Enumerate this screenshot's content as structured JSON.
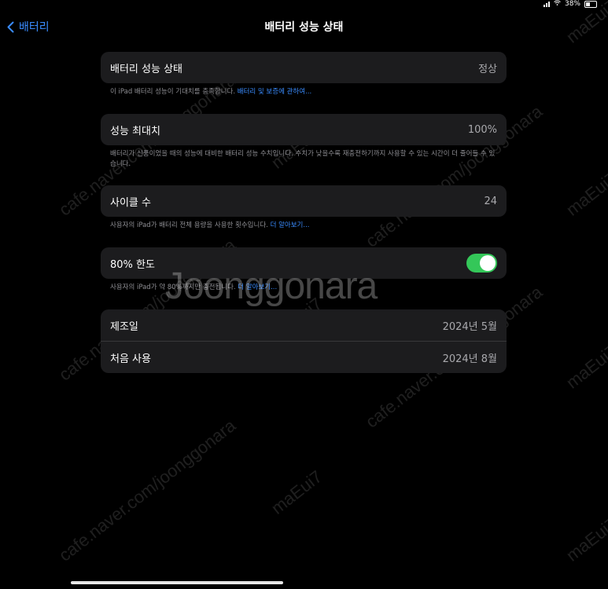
{
  "status_bar": {
    "battery_pct": "38%"
  },
  "nav": {
    "back_label": "배터리",
    "title": "배터리 성능 상태"
  },
  "health": {
    "label": "배터리 성능 상태",
    "value": "정상",
    "footnote": "이 iPad 배터리 성능이 기대치를 충족합니다.",
    "footnote_link": "배터리 및 보증에 관하여..."
  },
  "max_capacity": {
    "label": "성능 최대치",
    "value": "100%",
    "footnote": "배터리가 신품이었을 때의 성능에 대비한 배터리 성능 수치입니다. 수치가 낮을수록 재충전하기까지 사용할 수 있는 시간이 더 줄어들 수 있습니다."
  },
  "cycle_count": {
    "label": "사이클 수",
    "value": "24",
    "footnote": "사용자의 iPad가 배터리 전체 용량을 사용한 횟수입니다.",
    "footnote_link": "더 알아보기..."
  },
  "limit": {
    "label": "80% 한도",
    "enabled": true,
    "footnote": "사용자의 iPad가 약 80%까지만 충전됩니다.",
    "footnote_link": "더 알아보기..."
  },
  "dates": {
    "manufacture_label": "제조일",
    "manufacture_value": "2024년 5월",
    "first_use_label": "처음 사용",
    "first_use_value": "2024년 8월"
  },
  "watermarks": {
    "center": "Joonggonara",
    "url": "cafe.naver.com/joonggonara",
    "user": "maEui7"
  }
}
